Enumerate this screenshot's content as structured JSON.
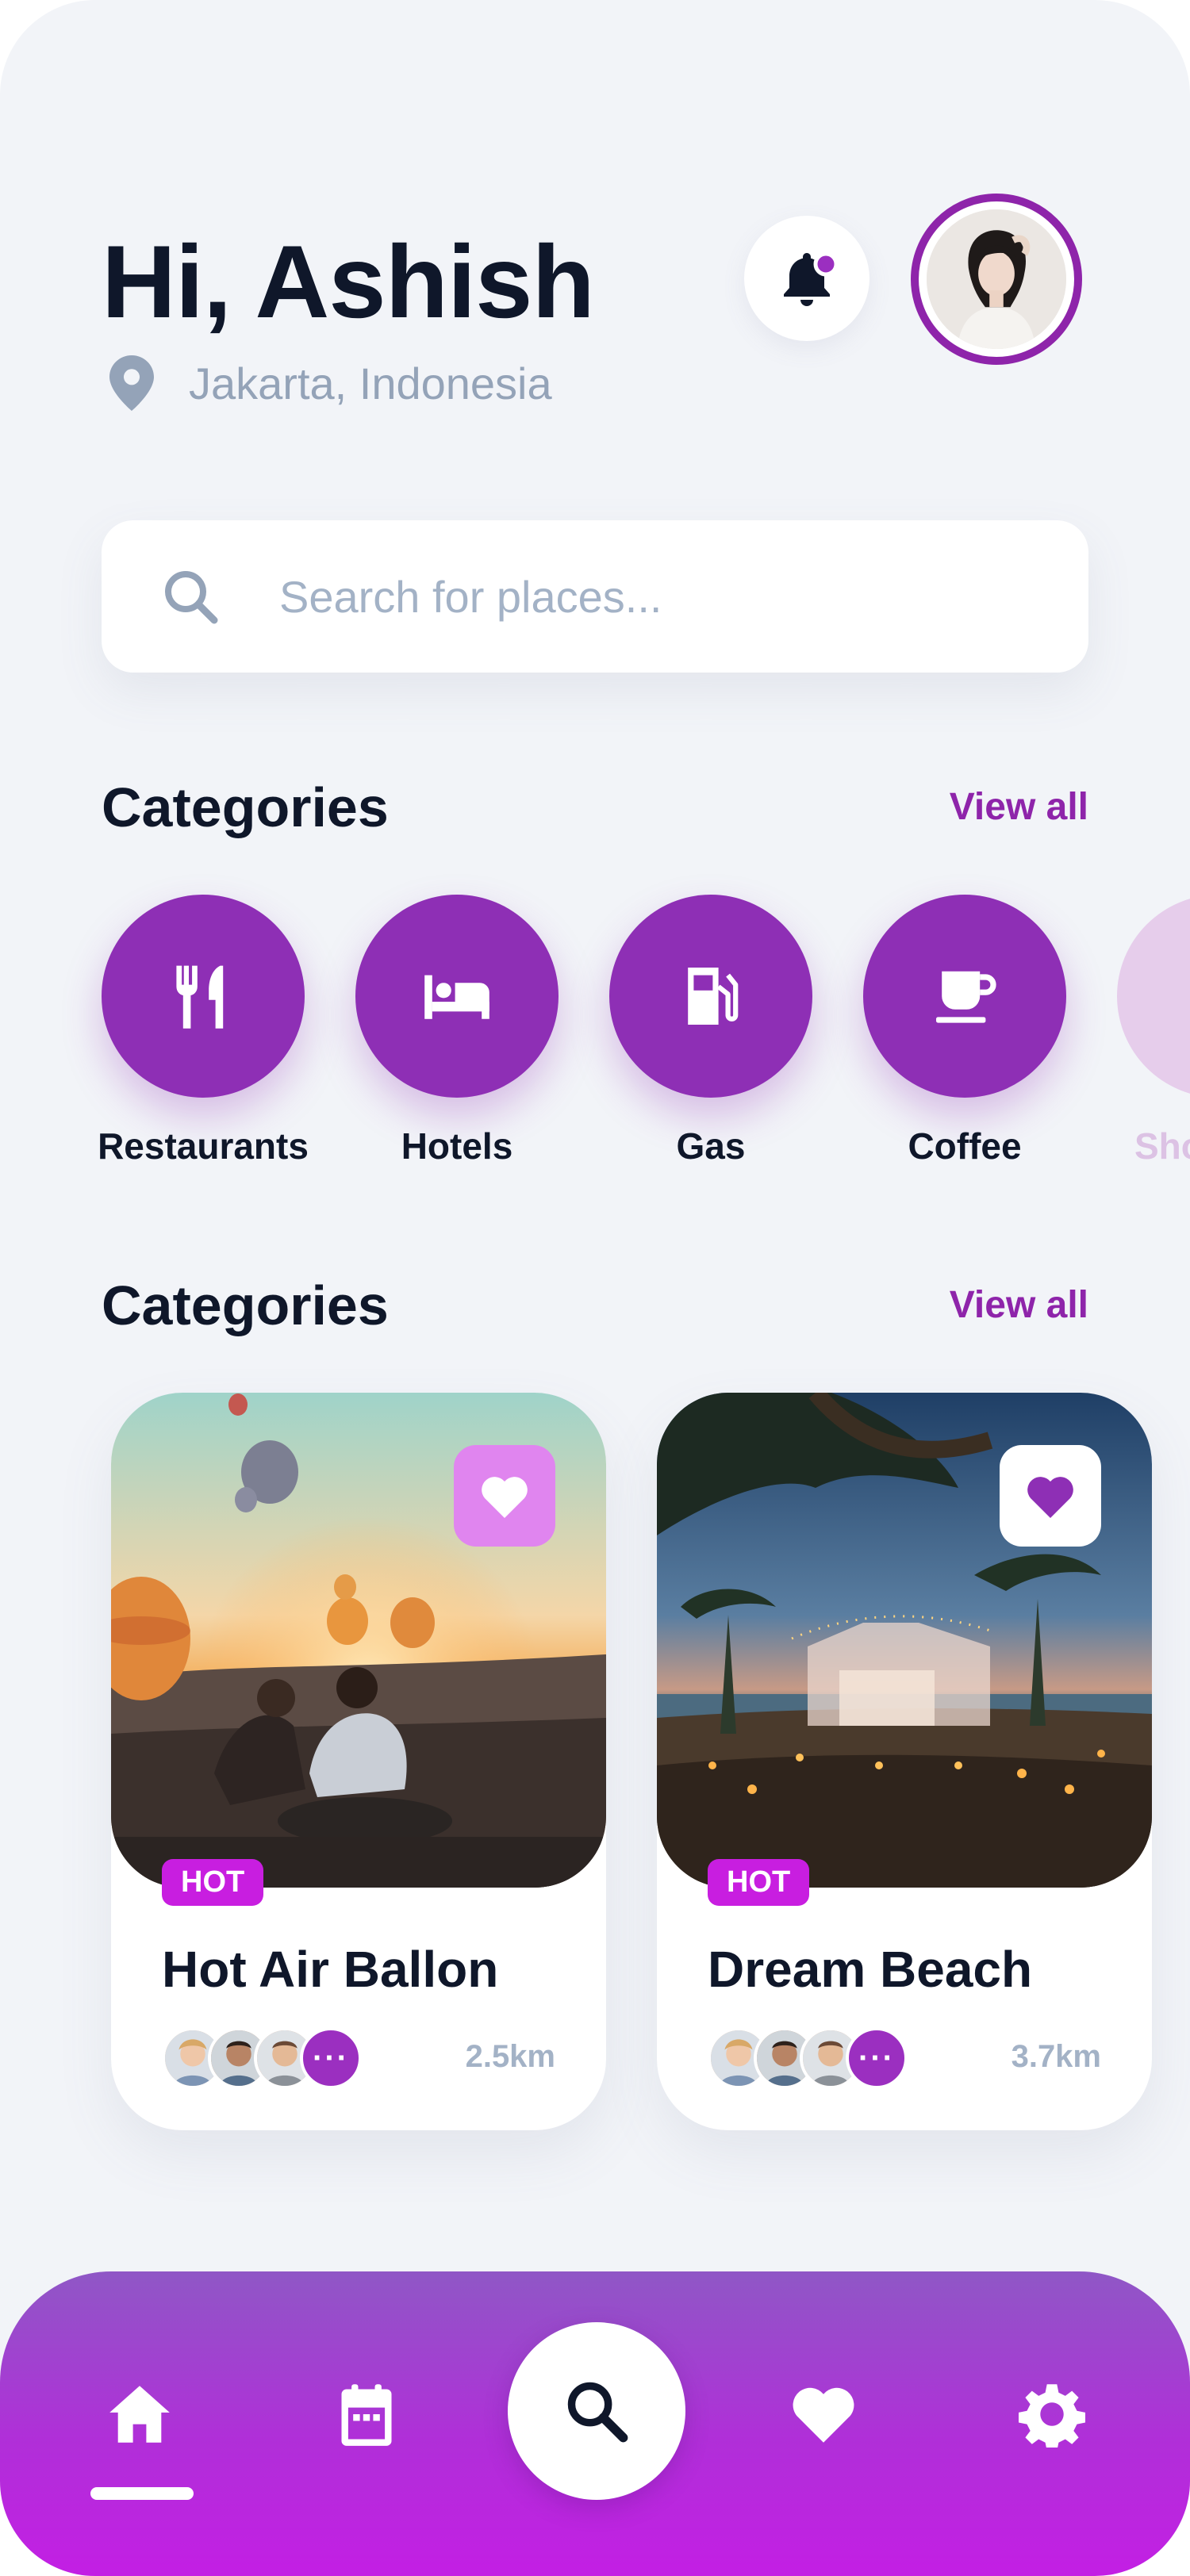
{
  "header": {
    "greeting": "Hi, Ashish",
    "location": "Jakarta, Indonesia",
    "notification_dot_color": "#9b2fc0"
  },
  "search": {
    "placeholder": "Search for places..."
  },
  "categories_section": {
    "title": "Categories",
    "view_all": "View all",
    "items": [
      {
        "label": "Restaurants",
        "icon": "fork-knife-icon"
      },
      {
        "label": "Hotels",
        "icon": "bed-icon"
      },
      {
        "label": "Gas",
        "icon": "gas-pump-icon"
      },
      {
        "label": "Coffee",
        "icon": "coffee-cup-icon"
      },
      {
        "label": "Shopping",
        "icon": "shopping-icon"
      }
    ]
  },
  "places_section": {
    "title": "Categories",
    "view_all": "View all",
    "cards": [
      {
        "badge": "HOT",
        "title": "Hot Air Ballon",
        "distance": "2.5km",
        "favorited": false,
        "more": "···"
      },
      {
        "badge": "HOT",
        "title": "Dream Beach",
        "distance": "3.7km",
        "favorited": true,
        "more": "···"
      }
    ]
  },
  "bottom_nav": {
    "items": [
      "home-icon",
      "calendar-icon",
      "search-icon",
      "heart-icon",
      "settings-icon"
    ],
    "active": "home-icon"
  },
  "colors": {
    "accent": "#8e24aa",
    "category_circle": "#8e2fb5",
    "badge": "#c81ee0",
    "nav_gradient_start": "#8f57c6",
    "nav_gradient_end": "#c31fe4"
  }
}
